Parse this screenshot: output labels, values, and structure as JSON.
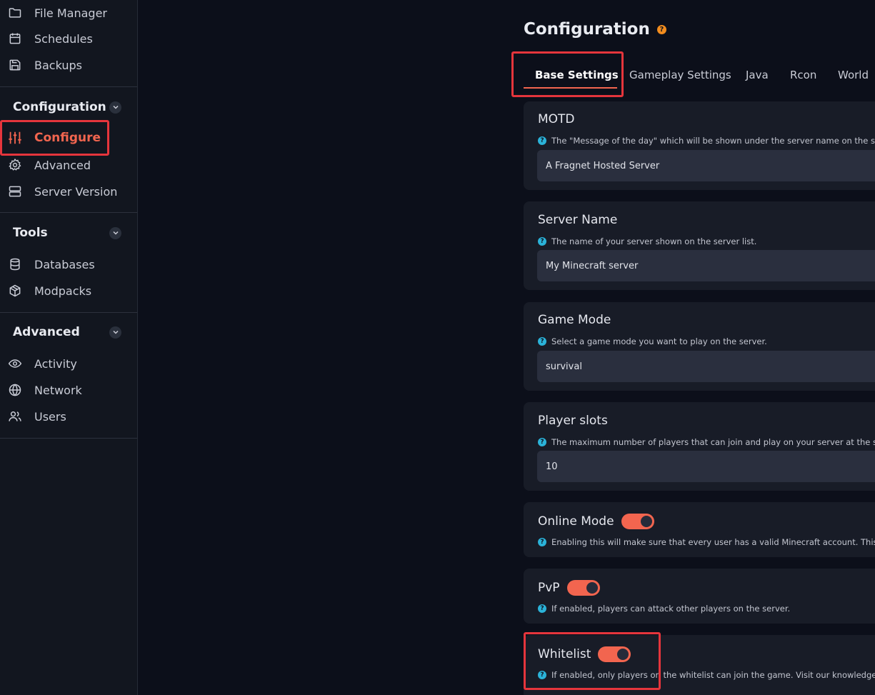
{
  "sidebar": {
    "top_items": [
      {
        "label": "File Manager",
        "icon": "folder-icon"
      },
      {
        "label": "Schedules",
        "icon": "calendar-icon"
      },
      {
        "label": "Backups",
        "icon": "save-icon"
      }
    ],
    "sections": [
      {
        "title": "Configuration",
        "items": [
          {
            "label": "Configure",
            "icon": "sliders-icon",
            "active": true
          },
          {
            "label": "Advanced",
            "icon": "gear-icon"
          },
          {
            "label": "Server Version",
            "icon": "server-icon"
          }
        ]
      },
      {
        "title": "Tools",
        "items": [
          {
            "label": "Databases",
            "icon": "database-icon"
          },
          {
            "label": "Modpacks",
            "icon": "package-icon"
          }
        ]
      },
      {
        "title": "Advanced",
        "items": [
          {
            "label": "Activity",
            "icon": "eye-icon"
          },
          {
            "label": "Network",
            "icon": "globe-icon"
          },
          {
            "label": "Users",
            "icon": "users-icon"
          }
        ]
      }
    ]
  },
  "main": {
    "title": "Configuration",
    "help_glyph": "?",
    "tabs": [
      {
        "label": "Base Settings",
        "active": true
      },
      {
        "label": "Gameplay Settings"
      },
      {
        "label": "Java"
      },
      {
        "label": "Rcon"
      },
      {
        "label": "World"
      }
    ],
    "settings": [
      {
        "title": "MOTD",
        "description": "The \"Message of the day\" which will be shown under the server name on the serve",
        "value": "A Fragnet Hosted Server"
      },
      {
        "title": "Server Name",
        "description": "The name of your server shown on the server list.",
        "value": "My Minecraft server"
      },
      {
        "title": "Game Mode",
        "description": "Select a game mode you want to play on the server.",
        "value": "survival"
      },
      {
        "title": "Player slots",
        "description": "The maximum number of players that can join and play on your server at the same",
        "value": "10"
      },
      {
        "title": "Online Mode",
        "description": "Enabling this will make sure that every user has a valid Minecraft account. This pre",
        "enabled": true
      },
      {
        "title": "PvP",
        "description": "If enabled, players can attack other players on the server.",
        "enabled": true
      },
      {
        "title": "Whitelist",
        "description": "If enabled, only players on the whitelist can join the game. Visit our knowledgebas",
        "enabled": true
      }
    ]
  },
  "colors": {
    "accent": "#f2654f",
    "highlight": "#e5353c",
    "info": "#2bb3d9",
    "help": "#f28c1e"
  }
}
